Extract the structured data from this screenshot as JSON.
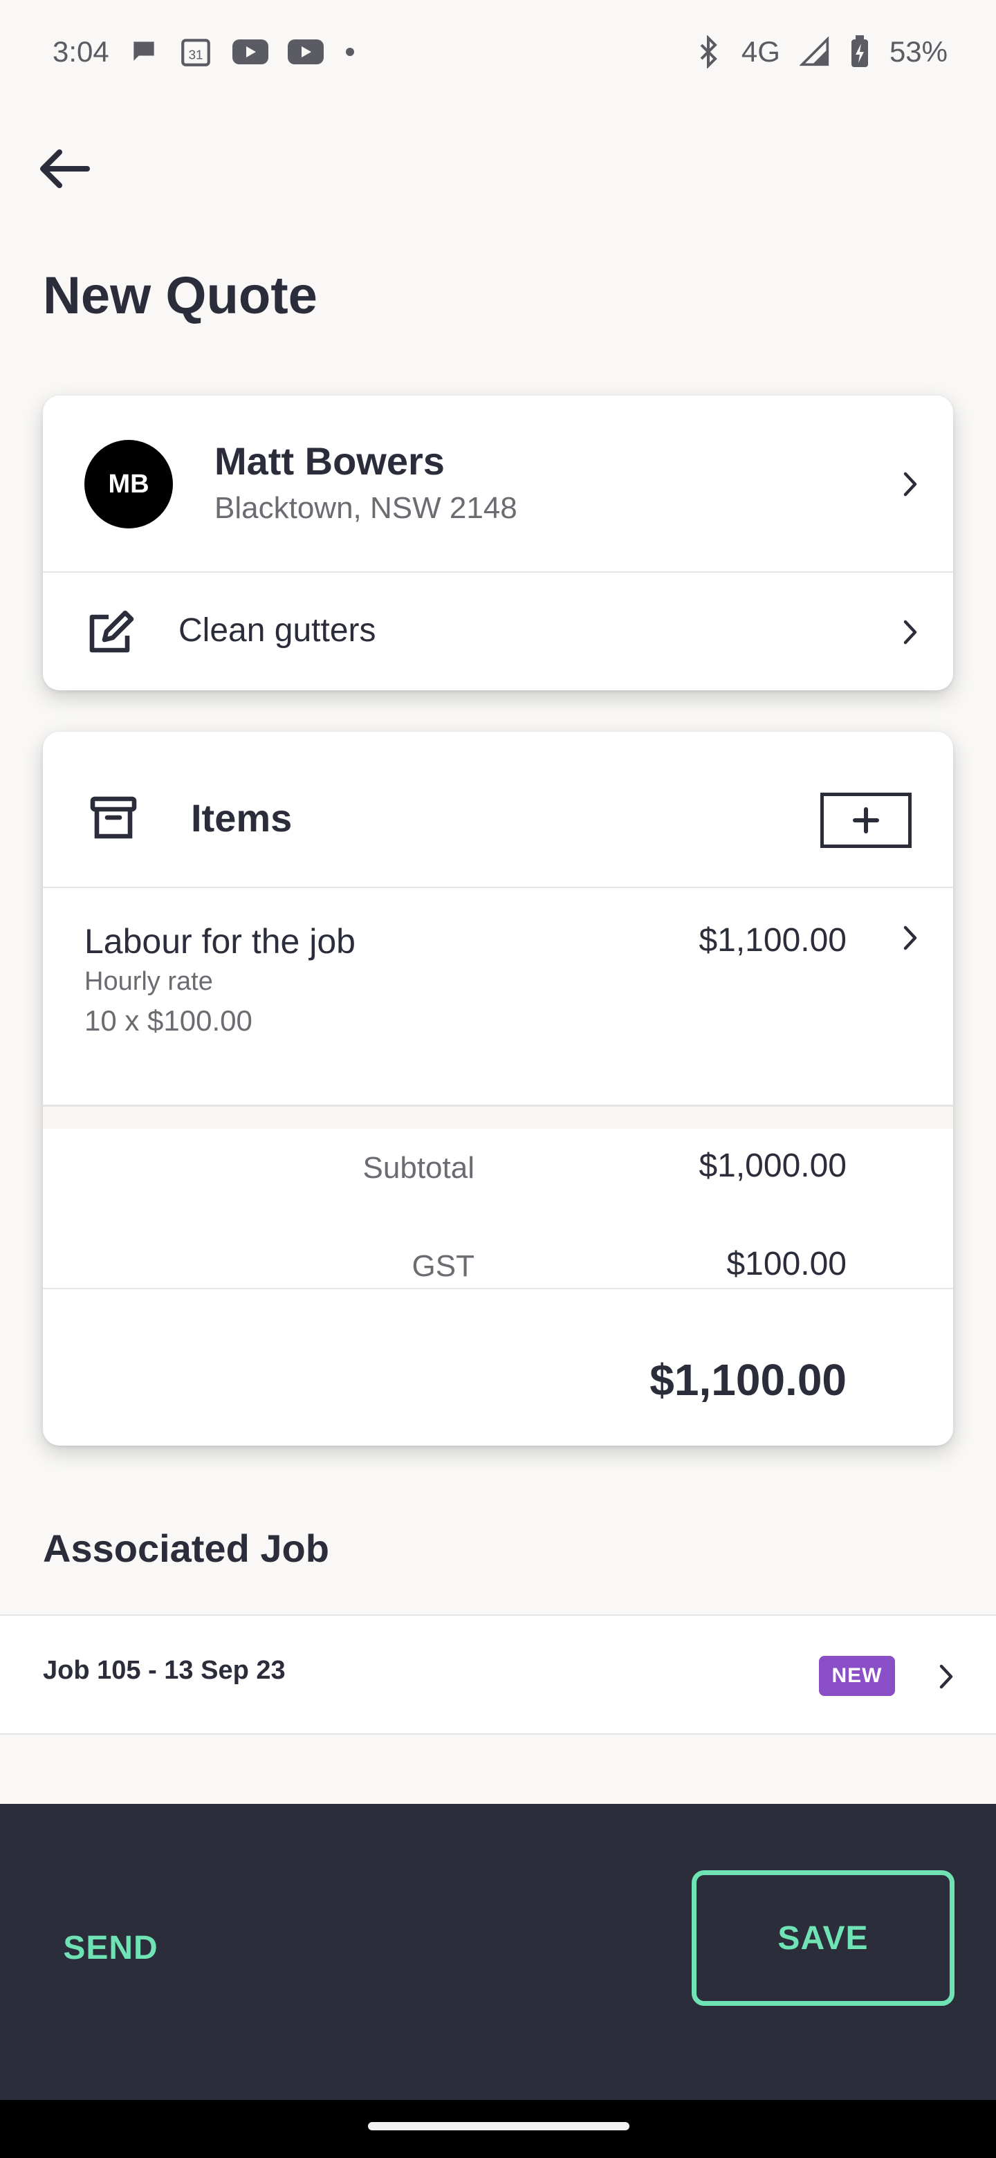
{
  "status_bar": {
    "time": "3:04",
    "network": "4G",
    "battery": "53%",
    "calendar_day": "31",
    "icons": [
      "chat-icon",
      "calendar-icon",
      "youtube-icon",
      "youtube-icon",
      "dot-icon",
      "bluetooth-icon",
      "signal-icon",
      "battery-icon"
    ]
  },
  "header": {
    "title": "New Quote"
  },
  "client": {
    "initials": "MB",
    "name": "Matt Bowers",
    "address": "Blacktown, NSW 2148",
    "description": "Clean gutters"
  },
  "items": {
    "title": "Items",
    "line_items": [
      {
        "title": "Labour for the job",
        "rate_type": "Hourly rate",
        "quantity": "10 x $100.00",
        "amount": "$1,100.00"
      }
    ],
    "subtotal_label": "Subtotal",
    "subtotal": "$1,000.00",
    "gst_label": "GST",
    "gst": "$100.00",
    "total": "$1,100.00"
  },
  "associated_job": {
    "section_title": "Associated Job",
    "label": "Job 105 - 13 Sep 23",
    "badge": "NEW"
  },
  "actions": {
    "send": "SEND",
    "save": "SAVE"
  },
  "colors": {
    "accent": "#6fe3b4",
    "dark": "#2b2d3b",
    "badge": "#8a4fc6"
  }
}
